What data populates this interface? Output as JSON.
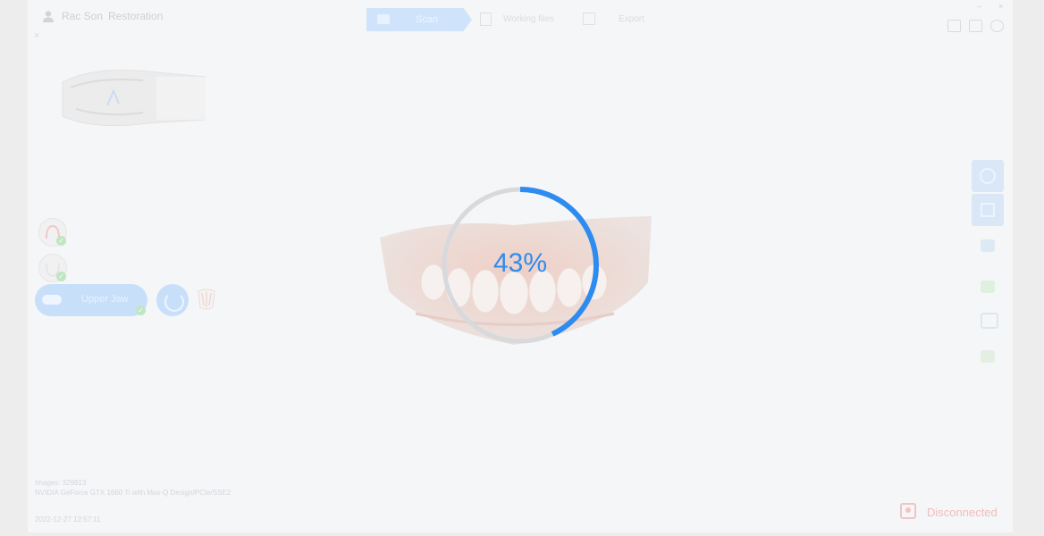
{
  "header": {
    "user_name": "Rac Son",
    "case_type": "Restoration",
    "close_glyph": "×",
    "steps": [
      {
        "label": "Scan",
        "icon": "scan-icon",
        "active": true
      },
      {
        "label": "Working files",
        "icon": "document-icon",
        "active": false
      },
      {
        "label": "Export",
        "icon": "export-icon",
        "active": false
      }
    ],
    "window_controls": {
      "minimize": "–",
      "close": "×"
    }
  },
  "left_panel": {
    "upper_jaw_label": "Upper Jaw",
    "tools": [
      "lower-jaw-icon",
      "upper-jaw-icon",
      "scan-icon",
      "bite-icon"
    ]
  },
  "progress": {
    "percent_text": "43%",
    "fraction": 0.43,
    "color": "#2e8bf0",
    "track_color": "#d7d9dc"
  },
  "status": {
    "images": "Images: 329913",
    "gpu": "NVIDIA GeForce GTX 1660 Ti with Max-Q Design/PCIe/SSE2",
    "timestamp": "2022-12-27 12:57:11",
    "connection": "Disconnected",
    "connection_color": "#f3bcbc"
  }
}
